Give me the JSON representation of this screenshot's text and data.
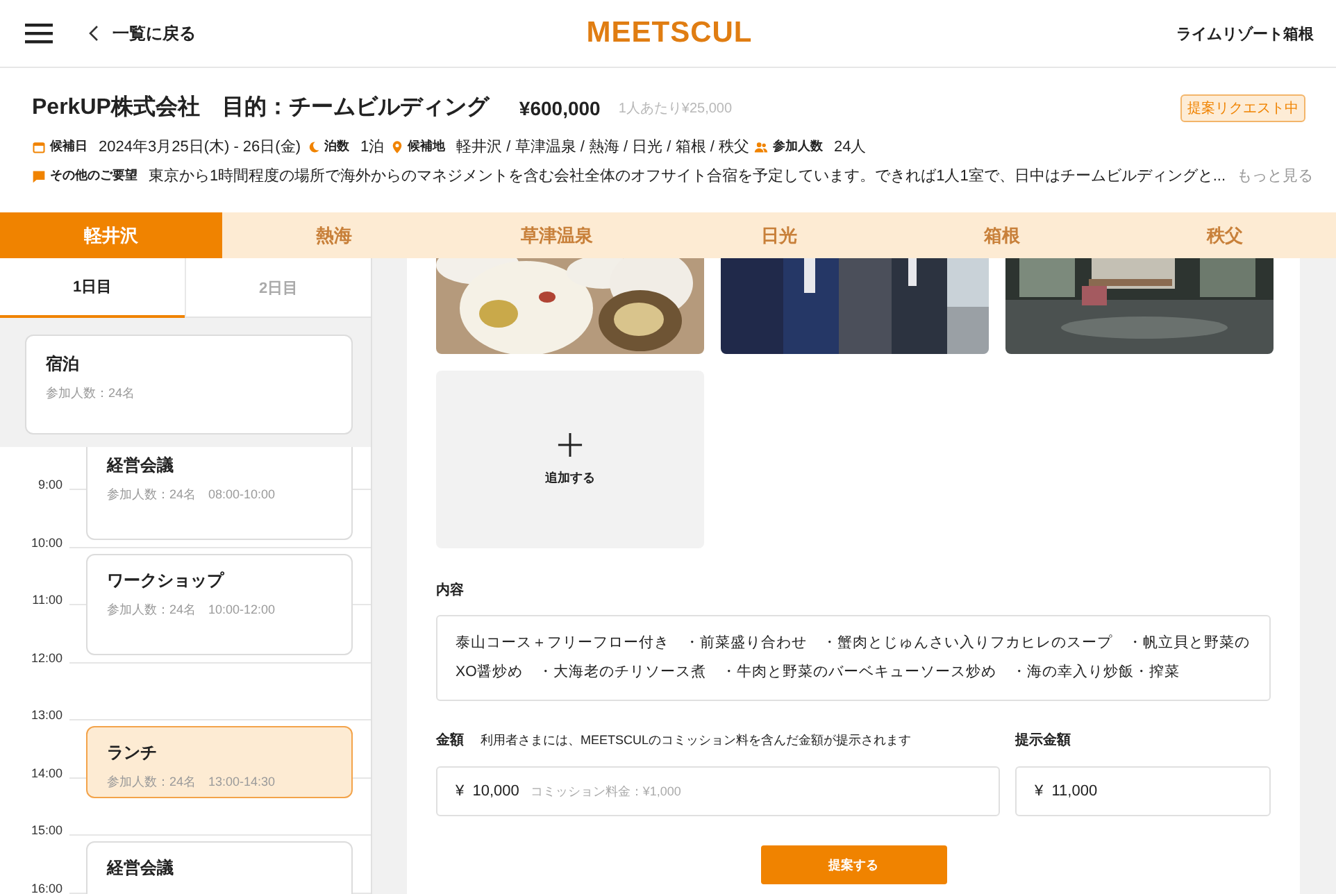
{
  "header": {
    "back_label": "一覧に戻る",
    "logo": "MEETSCUL",
    "venue": "ライムリゾート箱根"
  },
  "request": {
    "title": "PerkUP株式会社　目的：チームビルディング",
    "price": "¥600,000",
    "per_person": "1人あたり¥25,000",
    "status": "提案リクエスト中",
    "meta": [
      {
        "kind": "calendar",
        "label": "候補日",
        "value": "2024年3月25日(木) - 26日(金)"
      },
      {
        "kind": "moon",
        "label": "泊数",
        "value": "1泊"
      },
      {
        "kind": "pin",
        "label": "候補地",
        "value": "軽井沢 / 草津温泉 / 熱海 / 日光 / 箱根 / 秩父"
      },
      {
        "kind": "people",
        "label": "参加人数",
        "value": "24人"
      }
    ],
    "notes_label": "その他のご要望",
    "notes": "東京から1時間程度の場所で海外からのマネジメントを含む会社全体のオフサイト合宿を予定しています。できれば1人1室で、日中はチームビルディングと...",
    "more": "もっと見る"
  },
  "location_tabs": [
    {
      "label": "軽井沢",
      "selected": true
    },
    {
      "label": "熱海",
      "selected": false
    },
    {
      "label": "草津温泉",
      "selected": false
    },
    {
      "label": "日光",
      "selected": false
    },
    {
      "label": "箱根",
      "selected": false
    },
    {
      "label": "秩父",
      "selected": false
    }
  ],
  "day_tabs": [
    {
      "label": "1日目",
      "selected": true
    },
    {
      "label": "2日目",
      "selected": false
    }
  ],
  "stay_card": {
    "title": "宿泊",
    "detail": "参加人数：24名"
  },
  "timeline": {
    "hours": [
      "9:00",
      "10:00",
      "11:00",
      "12:00",
      "13:00",
      "14:00",
      "15:00",
      "16:00"
    ],
    "events": [
      {
        "title": "経営会議",
        "detail": "参加人数：24名　08:00-10:00",
        "selected": false
      },
      {
        "title": "ワークショップ",
        "detail": "参加人数：24名　10:00-12:00",
        "selected": false
      },
      {
        "title": "ランチ",
        "detail": "参加人数：24名　13:00-14:30",
        "selected": true
      },
      {
        "title": "経営会議",
        "selected": false
      }
    ]
  },
  "editor": {
    "photos": [
      {
        "kind": "food"
      },
      {
        "kind": "people"
      },
      {
        "kind": "interior"
      }
    ],
    "add_label": "追加する",
    "content_label": "内容",
    "content": "泰山コース＋フリーフロー付き　・前菜盛り合わせ　・蟹肉とじゅんさい入りフカヒレのスープ　・帆立貝と野菜のXO醤炒め　・大海老のチリソース煮　・牛肉と野菜のバーベキューソース炒め　・海の幸入り炒飯・搾菜",
    "amount_label": "金額",
    "amount_note": "利用者さまには、MEETSCULのコミッション料を含んだ金額が提示されます",
    "amount_value": "¥  10,000",
    "commission": "コミッション料金：¥1,000",
    "offer_label": "提示金額",
    "offer_value": "¥  11,000",
    "submit": "提案する"
  }
}
